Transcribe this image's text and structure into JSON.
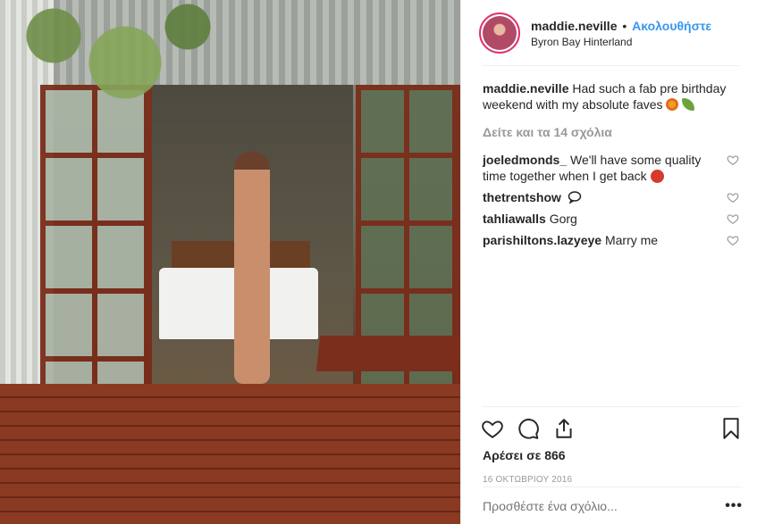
{
  "post": {
    "username": "maddie.neville",
    "follow_label": "Ακολουθήστε",
    "location": "Byron Bay Hinterland",
    "caption_text": "Had such a fab pre birthday weekend with my absolute faves",
    "view_all_comments": "Δείτε και τα 14 σχόλια",
    "comments": [
      {
        "user": "joeledmonds_",
        "text": "We'll have some quality time together when I get back"
      },
      {
        "user": "thetrentshow",
        "text": ""
      },
      {
        "user": "tahliawalls",
        "text": "Gorg"
      },
      {
        "user": "parishiltons.lazyeye",
        "text": "Marry me"
      }
    ],
    "likes": "Αρέσει σε 866",
    "date": "16 ΟΚΤΩΒΡΙΟΥ 2016",
    "comment_placeholder": "Προσθέστε ένα σχόλιο...",
    "more_label": "•••"
  },
  "colors": {
    "link": "#3897f0",
    "muted": "#999999",
    "text": "#262626",
    "ring": "#e1306c"
  },
  "icons": [
    "heart-icon",
    "comment-icon",
    "share-icon",
    "bookmark-icon",
    "more-icon"
  ]
}
